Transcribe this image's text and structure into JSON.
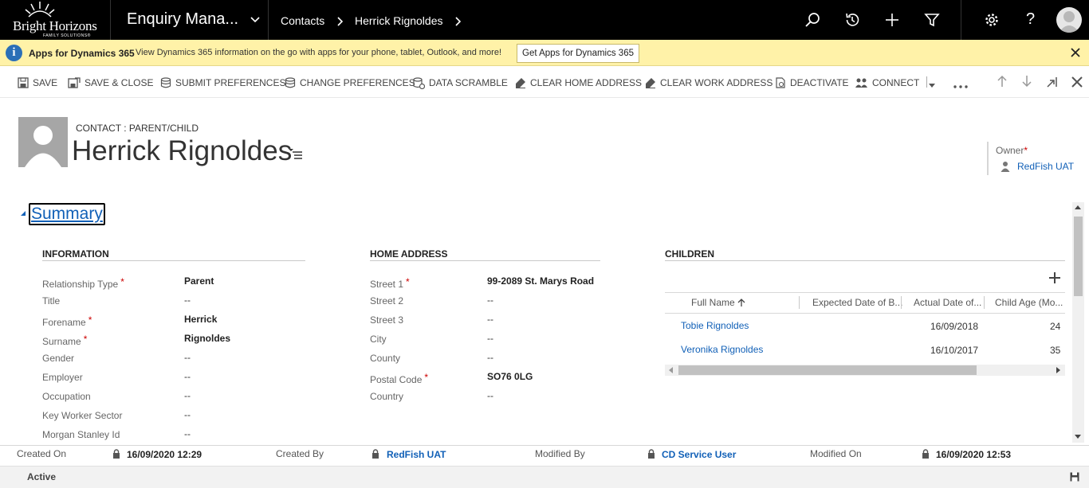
{
  "nav": {
    "logo_text": "Bright Horizons",
    "logo_sub": "FAMILY SOLUTIONS®",
    "app_title": "Enquiry Mana...",
    "breadcrumb": [
      "Contacts",
      "Herrick Rignoldes"
    ]
  },
  "notification": {
    "title": "Apps for Dynamics 365",
    "message": "View Dynamics 365 information on the go with apps for your phone, tablet, Outlook, and more!",
    "button": "Get Apps for Dynamics 365"
  },
  "commands": {
    "save": "SAVE",
    "save_close": "SAVE & CLOSE",
    "submit_prefs": "SUBMIT PREFERENCES",
    "change_prefs": "CHANGE PREFERENCES",
    "data_scramble": "DATA SCRAMBLE",
    "clear_home": "CLEAR HOME ADDRESS",
    "clear_work": "CLEAR WORK ADDRESS",
    "deactivate": "DEACTIVATE",
    "connect": "CONNECT"
  },
  "record": {
    "entity": "CONTACT : PARENT/CHILD",
    "name": "Herrick Rignoldes",
    "owner_label": "Owner",
    "owner_value": "RedFish UAT",
    "required_mark": "*"
  },
  "summary": {
    "title": "Summary",
    "information": {
      "title": "INFORMATION",
      "fields": [
        {
          "label": "Relationship Type",
          "value": "Parent",
          "required": true
        },
        {
          "label": "Title",
          "value": "--",
          "required": false
        },
        {
          "label": "Forename",
          "value": "Herrick",
          "required": true
        },
        {
          "label": "Surname",
          "value": "Rignoldes",
          "required": true
        },
        {
          "label": "Gender",
          "value": "--",
          "required": false
        },
        {
          "label": "Employer",
          "value": "--",
          "required": false
        },
        {
          "label": "Occupation",
          "value": "--",
          "required": false
        },
        {
          "label": "Key Worker Sector",
          "value": "--",
          "required": false
        },
        {
          "label": "Morgan Stanley Id",
          "value": "--",
          "required": false
        }
      ]
    },
    "home_address": {
      "title": "HOME ADDRESS",
      "fields": [
        {
          "label": "Street 1",
          "value": "99-2089 St. Marys Road",
          "required": true
        },
        {
          "label": "Street 2",
          "value": "--",
          "required": false
        },
        {
          "label": "Street 3",
          "value": "--",
          "required": false
        },
        {
          "label": "City",
          "value": "--",
          "required": false
        },
        {
          "label": "County",
          "value": "--",
          "required": false
        },
        {
          "label": "Postal Code",
          "value": "SO76 0LG",
          "required": true
        },
        {
          "label": "Country",
          "value": "--",
          "required": false
        }
      ]
    },
    "children": {
      "title": "CHILDREN",
      "columns": [
        "Full Name",
        "Expected Date of B...",
        "Actual Date of...",
        "Child Age (Mo..."
      ],
      "rows": [
        {
          "name": "Tobie Rignoldes",
          "expected": "",
          "actual": "16/09/2018",
          "age": "24"
        },
        {
          "name": "Veronika Rignoldes",
          "expected": "",
          "actual": "16/10/2017",
          "age": "35"
        }
      ]
    }
  },
  "footer": {
    "created_on_label": "Created On",
    "created_on": "16/09/2020  12:29",
    "created_by_label": "Created By",
    "created_by": "RedFish UAT",
    "modified_by_label": "Modified By",
    "modified_by": "CD Service User",
    "modified_on_label": "Modified On",
    "modified_on": "16/09/2020  12:53",
    "status": "Active"
  }
}
